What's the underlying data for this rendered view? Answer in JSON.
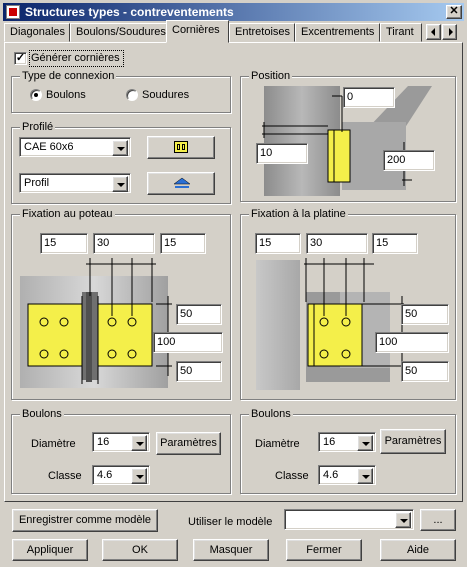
{
  "window": {
    "title": "Structures types - contreventements"
  },
  "tabs": [
    "Diagonales",
    "Boulons/Soudures",
    "Cornières",
    "Entretoises",
    "Excentrements",
    "Tirant"
  ],
  "active_tab": "Cornières",
  "generate_checkbox": {
    "label": "Générer cornières",
    "checked": true
  },
  "connection": {
    "title": "Type de connexion",
    "bolts_label": "Boulons",
    "welds_label": "Soudures",
    "selected": "Boulons"
  },
  "profile": {
    "title": "Profilé",
    "section_value": "CAE 60x6",
    "type_value": "Profil"
  },
  "position": {
    "title": "Position",
    "top_value": "0",
    "left_value": "10",
    "right_value": "200"
  },
  "column_fix": {
    "title": "Fixation au poteau",
    "dims": [
      "15",
      "30",
      "15"
    ],
    "side_values": [
      "50",
      "100",
      "50"
    ]
  },
  "plate_fix": {
    "title": "Fixation à la platine",
    "dims": [
      "15",
      "30",
      "15"
    ],
    "side_values": [
      "50",
      "100",
      "50"
    ]
  },
  "bolts_left": {
    "title": "Boulons",
    "diameter_label": "Diamètre",
    "diameter_value": "16",
    "class_label": "Classe",
    "class_value": "4.6",
    "params_button": "Paramètres"
  },
  "bolts_right": {
    "title": "Boulons",
    "diameter_label": "Diamètre",
    "diameter_value": "16",
    "class_label": "Classe",
    "class_value": "4.6",
    "params_button": "Paramètres"
  },
  "footer": {
    "save_model_button": "Enregistrer comme modèle",
    "use_model_label": "Utiliser le modèle",
    "model_value": "",
    "browse_button": "..."
  },
  "buttons": {
    "apply": "Appliquer",
    "ok": "OK",
    "hide": "Masquer",
    "close": "Fermer",
    "help": "Aide"
  }
}
